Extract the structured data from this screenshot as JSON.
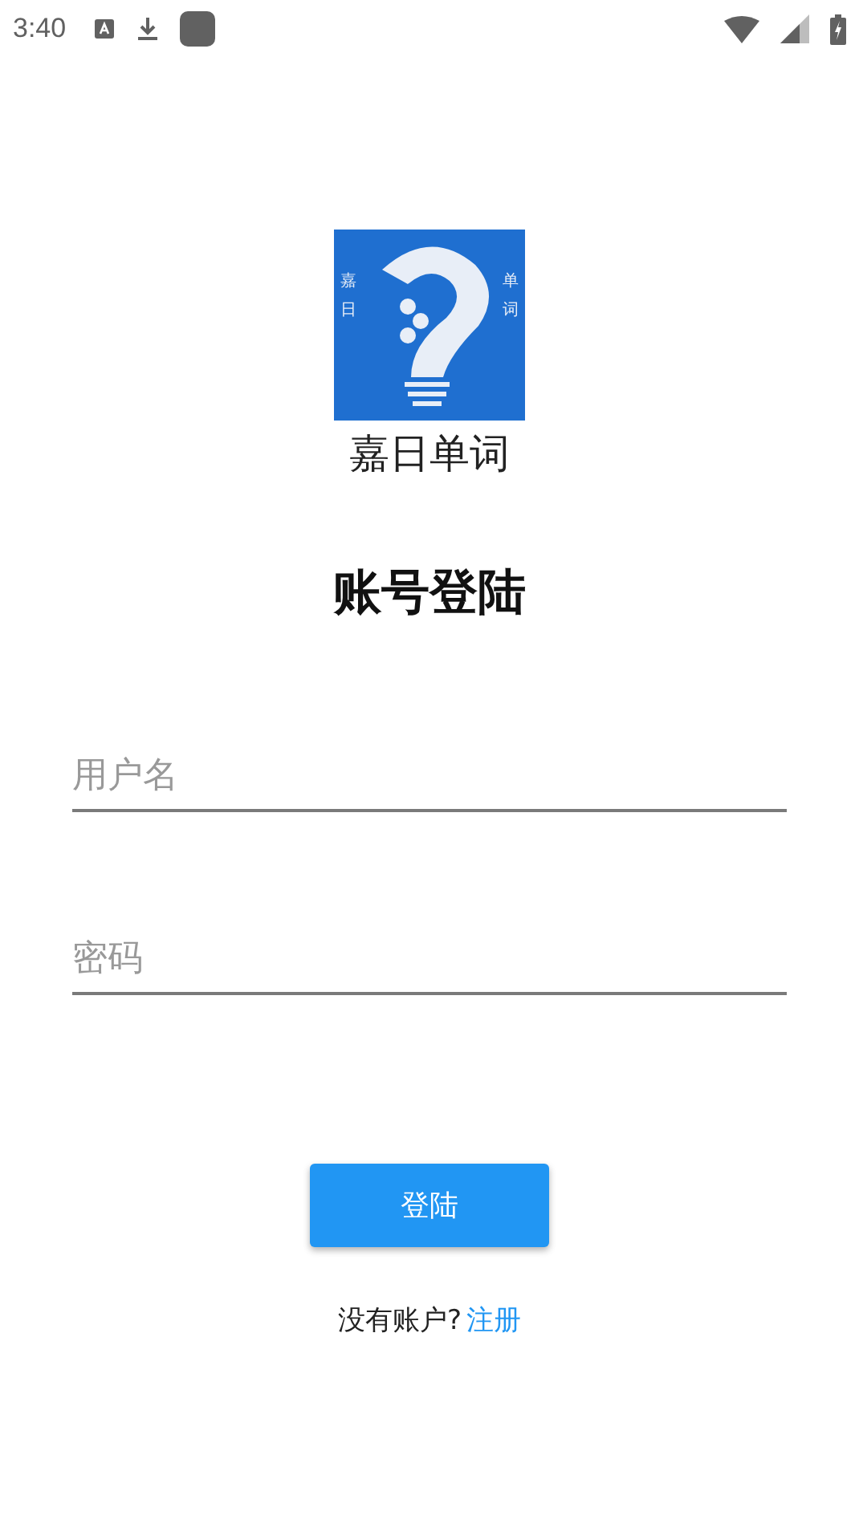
{
  "status_bar": {
    "time": "3:40"
  },
  "logo": {
    "left_text": "嘉日",
    "right_text": "单词"
  },
  "app_name": "嘉日单词",
  "title": "账号登陆",
  "fields": [
    {
      "placeholder": "用户名"
    },
    {
      "placeholder": "密码"
    }
  ],
  "login_button": "登陆",
  "register_prompt": {
    "text": "没有账户?",
    "link": "注册"
  }
}
